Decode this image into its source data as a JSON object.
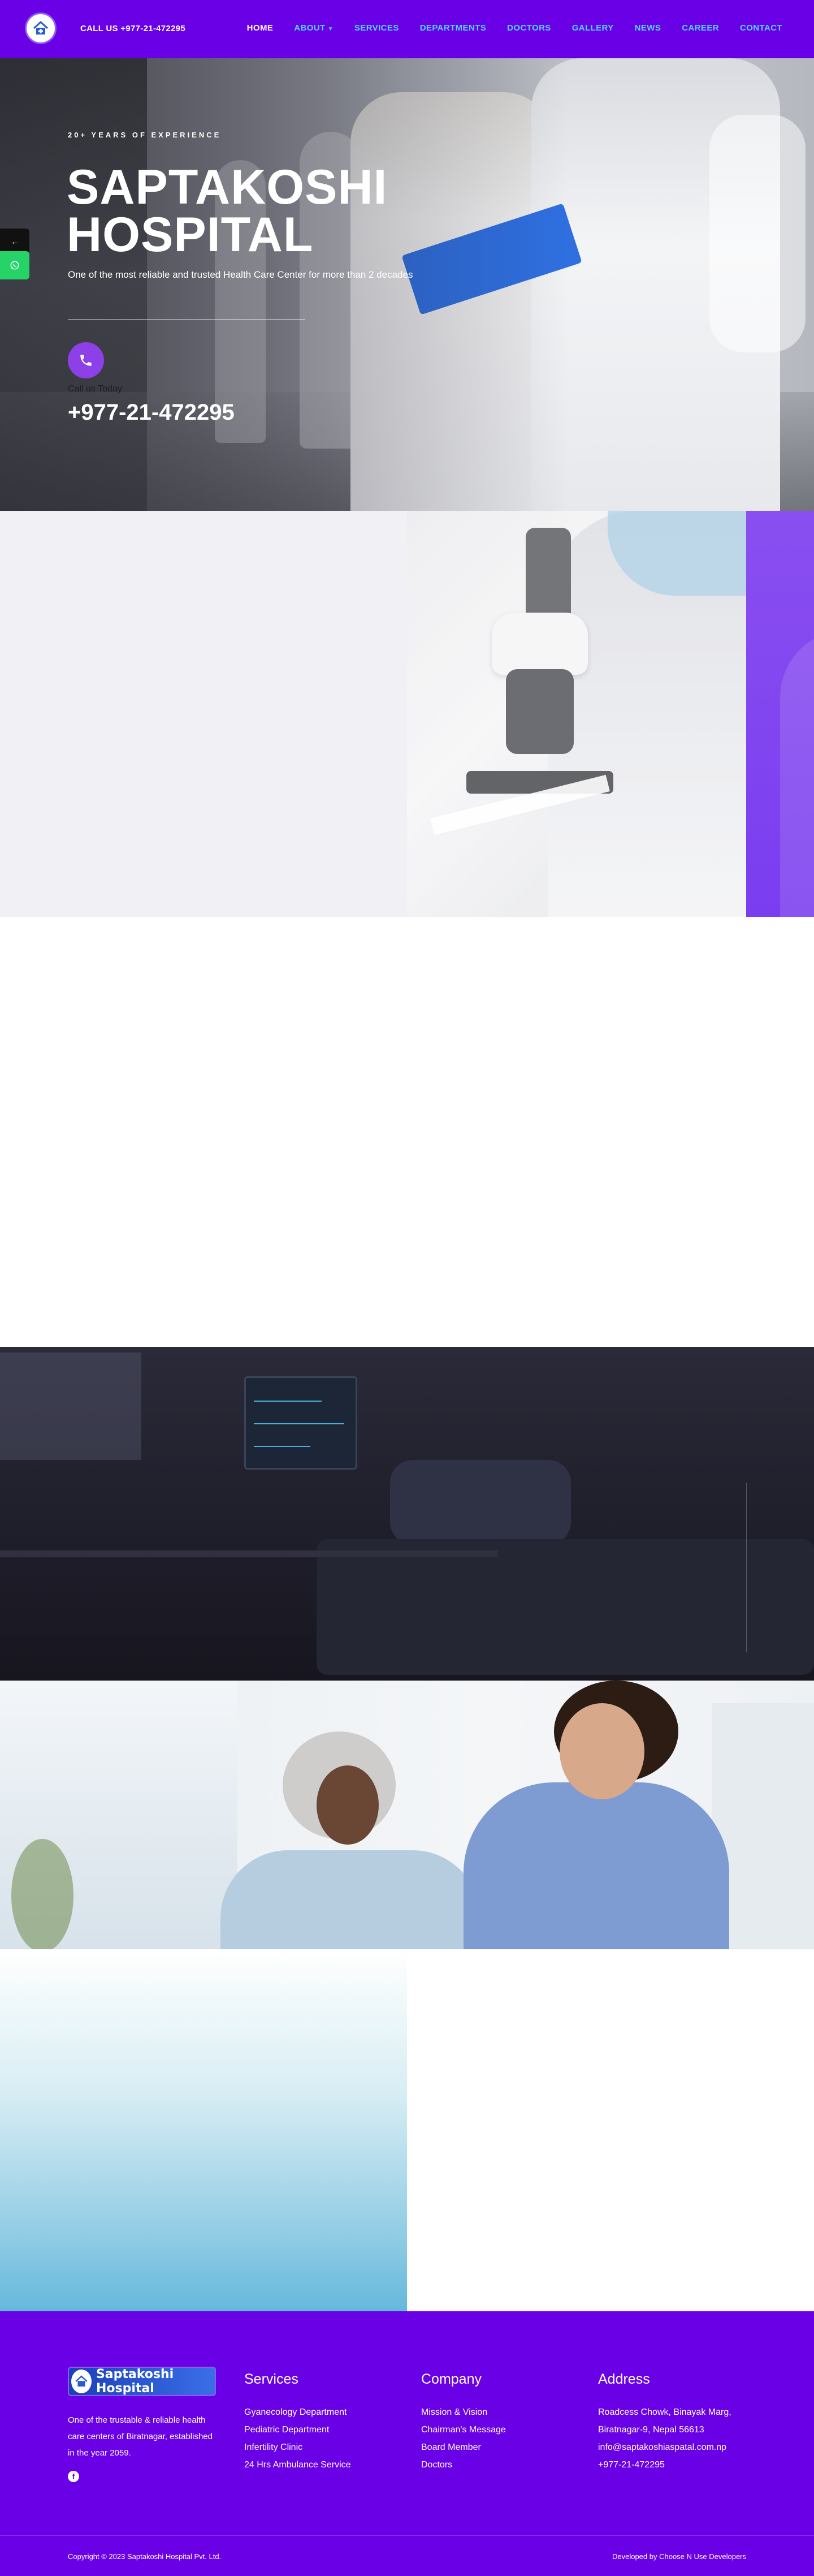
{
  "header": {
    "call_us": "CALL US +977-21-472295",
    "nav": [
      {
        "label": "HOME",
        "active": true
      },
      {
        "label": "ABOUT",
        "has_dropdown": true
      },
      {
        "label": "SERVICES"
      },
      {
        "label": "DEPARTMENTS"
      },
      {
        "label": "DOCTORS"
      },
      {
        "label": "GALLERY"
      },
      {
        "label": "NEWS"
      },
      {
        "label": "CAREER"
      },
      {
        "label": "CONTACT"
      }
    ],
    "dropdown_icon": "chevron-down-icon",
    "logo_icon": "hospital-logo-icon"
  },
  "hero": {
    "eyebrow": "20+ YEARS OF EXPERIENCE",
    "title_line1": "SAPTAKOSHI",
    "title_line2": "HOSPITAL",
    "tagline": "One of the most reliable and trusted Health Care Center for more than 2 decades",
    "call_label": "Call us Today",
    "phone": "+977-21-472295",
    "phone_icon": "phone-icon"
  },
  "floating": {
    "back_label": "←",
    "back_icon": "arrow-left-icon",
    "whatsapp_icon": "whatsapp-icon"
  },
  "footer": {
    "brand": "Saptakoshi Hospital",
    "about": "One of the trustable & reliable health care centers of Biratnagar, established in the year 2059.",
    "facebook_icon": "facebook-icon",
    "columns": [
      {
        "title": "Services",
        "links": [
          "Gyanecology Department",
          "Pediatric Department",
          "Infertility Clinic",
          "24 Hrs Ambulance Service"
        ]
      },
      {
        "title": "Company",
        "links": [
          "Mission & Vision",
          "Chairman's Message",
          "Board Member",
          "Doctors"
        ]
      },
      {
        "title": "Address",
        "links": [
          "Roadcess Chowk, Binayak Marg,",
          "Biratnagar-9, Nepal 56613",
          "info@saptakoshiaspatal.com.np",
          "+977-21-472295"
        ]
      }
    ],
    "copyright": "Copyright © 2023 Saptakoshi Hospital Pvt. Ltd.",
    "developed_by": "Developed by Choose N Use Developers"
  },
  "colors": {
    "brand_purple": "#6a00e6",
    "nav_link": "#52d6ff",
    "accent_violet": "#8d3fe8",
    "whatsapp_green": "#25d366"
  }
}
